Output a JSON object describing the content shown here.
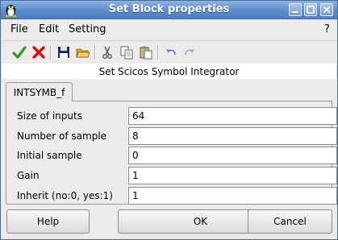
{
  "window": {
    "title": "Set Block properties"
  },
  "menu": {
    "file": "File",
    "edit": "Edit",
    "setting": "Setting",
    "help": "?"
  },
  "toolbar_icons": [
    "ok-check-icon",
    "cancel-x-icon",
    "save-icon",
    "open-folder-icon",
    "cut-icon",
    "copy-icon",
    "paste-icon",
    "undo-icon",
    "redo-icon"
  ],
  "header": {
    "text": "Set Scicos Symbol Integrator"
  },
  "tab": {
    "label": "INTSYMB_f"
  },
  "fields": [
    {
      "label": "Size of inputs",
      "value": "64"
    },
    {
      "label": "Number of sample",
      "value": "8"
    },
    {
      "label": "Initial sample",
      "value": "0"
    },
    {
      "label": "Gain",
      "value": "1"
    },
    {
      "label": "Inherit (no:0, yes:1)",
      "value": "1"
    }
  ],
  "buttons": {
    "help": "Help",
    "ok": "OK",
    "cancel": "Cancel"
  },
  "colors": {
    "titlebar": "#5b8ccc",
    "window_bg": "#ecebe9"
  }
}
